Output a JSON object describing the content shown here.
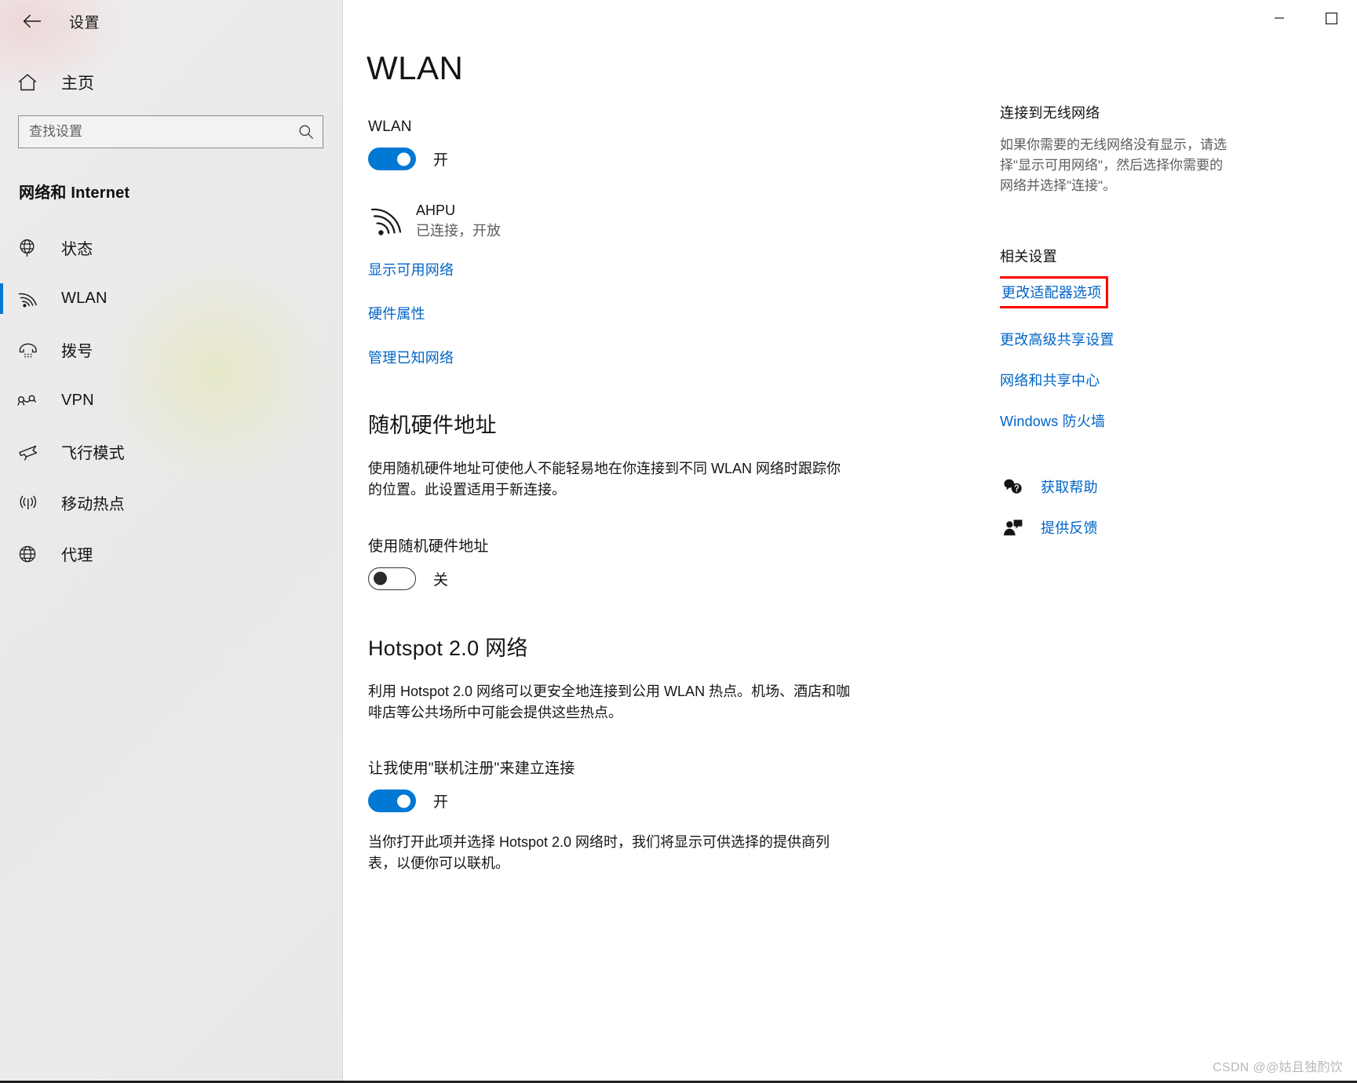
{
  "window": {
    "title": "设置",
    "back_icon": "back-arrow-icon",
    "minimize_icon": "minimize-icon",
    "maximize_icon": "maximize-icon"
  },
  "sidebar": {
    "home": {
      "label": "主页",
      "icon": "home-icon"
    },
    "search": {
      "placeholder": "查找设置",
      "value": "",
      "icon": "search-icon"
    },
    "category": "网络和 Internet",
    "items": [
      {
        "label": "状态",
        "icon": "globe-status-icon",
        "selected": false
      },
      {
        "label": "WLAN",
        "icon": "wifi-icon",
        "selected": true
      },
      {
        "label": "拨号",
        "icon": "dialup-phone-icon",
        "selected": false
      },
      {
        "label": "VPN",
        "icon": "vpn-icon",
        "selected": false
      },
      {
        "label": "飞行模式",
        "icon": "airplane-icon",
        "selected": false
      },
      {
        "label": "移动热点",
        "icon": "hotspot-icon",
        "selected": false
      },
      {
        "label": "代理",
        "icon": "proxy-globe-icon",
        "selected": false
      }
    ]
  },
  "main": {
    "page_title": "WLAN",
    "wlan": {
      "label": "WLAN",
      "toggle_state": "开",
      "toggle_on": true
    },
    "network": {
      "icon": "wifi-signal-icon",
      "name": "AHPU",
      "status": "已连接，开放"
    },
    "links": [
      {
        "label": "显示可用网络"
      },
      {
        "label": "硬件属性"
      },
      {
        "label": "管理已知网络"
      }
    ],
    "random_hw": {
      "heading": "随机硬件地址",
      "description": "使用随机硬件地址可使他人不能轻易地在你连接到不同 WLAN 网络时跟踪你的位置。此设置适用于新连接。",
      "toggle_label": "使用随机硬件地址",
      "toggle_state": "关",
      "toggle_on": false
    },
    "hotspot": {
      "heading": "Hotspot 2.0 网络",
      "description": "利用 Hotspot 2.0 网络可以更安全地连接到公用 WLAN 热点。机场、酒店和咖啡店等公共场所中可能会提供这些热点。",
      "toggle_label": "让我使用\"联机注册\"来建立连接",
      "toggle_state": "开",
      "toggle_on": true,
      "footnote": "当你打开此项并选择 Hotspot 2.0 网络时，我们将显示可供选择的提供商列表，以便你可以联机。"
    }
  },
  "right_rail": {
    "connect_heading": "连接到无线网络",
    "connect_desc_lines": [
      "如果你需要的无线网络没有显示，请选",
      "择\"显示可用网络\"，然后选择你需要的",
      "网络并选择\"连接\"。"
    ],
    "related_heading": "相关设置",
    "related_links": [
      {
        "label": "更改适配器选项",
        "highlighted": true
      },
      {
        "label": "更改高级共享设置",
        "highlighted": false
      },
      {
        "label": "网络和共享中心",
        "highlighted": false
      },
      {
        "label": "Windows 防火墙",
        "highlighted": false
      }
    ],
    "help_items": [
      {
        "label": "获取帮助",
        "icon": "help-question-bubble-icon"
      },
      {
        "label": "提供反馈",
        "icon": "feedback-person-icon"
      }
    ],
    "highlight_color": "#ff0000",
    "link_color": "#0064c8"
  },
  "watermark": "CSDN @@姑且独酌饮"
}
